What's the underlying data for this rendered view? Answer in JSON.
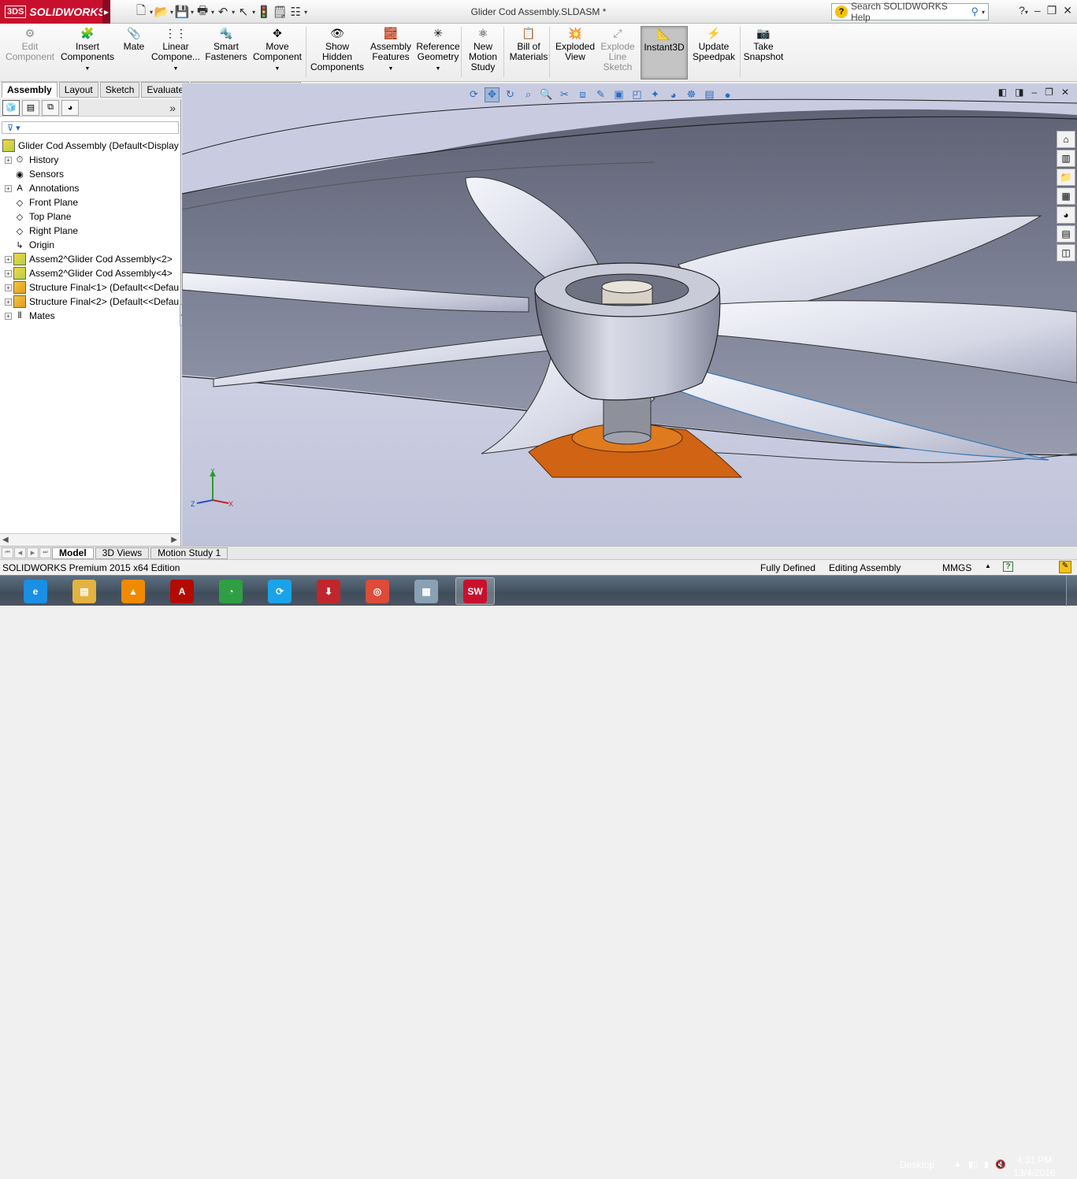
{
  "app": {
    "brand": "SOLIDWORKS",
    "brand_prefix": "3DS",
    "doc_title": "Glider Cod Assembly.SLDASM *",
    "search_placeholder": "Search SOLIDWORKS Help",
    "brand_color": "#c8102e"
  },
  "quickaccess": [
    {
      "name": "new-document-icon",
      "glyph": "🗋"
    },
    {
      "name": "open-folder-icon",
      "glyph": "📂"
    },
    {
      "name": "save-icon",
      "glyph": "💾"
    },
    {
      "name": "print-icon",
      "glyph": "🖶"
    },
    {
      "name": "undo-icon",
      "glyph": "↶"
    },
    {
      "name": "select-pointer-icon",
      "glyph": "↖"
    },
    {
      "name": "rebuild-icon",
      "glyph": "🚦"
    },
    {
      "name": "file-properties-icon",
      "glyph": "🗒"
    },
    {
      "name": "options-icon",
      "glyph": "☷"
    }
  ],
  "ribbon": [
    {
      "label_lines": [
        "Edit",
        "Component"
      ],
      "disabled": true,
      "icon": "edit-component-icon",
      "glyph": "⚙"
    },
    {
      "label_lines": [
        "Insert",
        "Components"
      ],
      "dropdown": true,
      "icon": "insert-components-icon",
      "glyph": "🧩"
    },
    {
      "label_lines": [
        "Mate"
      ],
      "icon": "mate-icon",
      "glyph": "📎"
    },
    {
      "label_lines": [
        "Linear",
        "Compone..."
      ],
      "dropdown": true,
      "icon": "linear-pattern-icon",
      "glyph": "⋮⋮"
    },
    {
      "label_lines": [
        "Smart",
        "Fasteners"
      ],
      "icon": "smart-fasteners-icon",
      "glyph": "🔩"
    },
    {
      "label_lines": [
        "Move",
        "Component"
      ],
      "dropdown": true,
      "icon": "move-component-icon",
      "glyph": "✥"
    },
    {
      "label_lines": [
        "Show",
        "Hidden",
        "Components"
      ],
      "icon": "show-hidden-icon",
      "glyph": "👁"
    },
    {
      "label_lines": [
        "Assembly",
        "Features"
      ],
      "dropdown": true,
      "icon": "assembly-features-icon",
      "glyph": "🧱"
    },
    {
      "label_lines": [
        "Reference",
        "Geometry"
      ],
      "dropdown": true,
      "icon": "reference-geometry-icon",
      "glyph": "✳"
    },
    {
      "label_lines": [
        "New",
        "Motion",
        "Study"
      ],
      "icon": "motion-study-icon",
      "glyph": "⚛"
    },
    {
      "label_lines": [
        "Bill of",
        "Materials"
      ],
      "icon": "bill-of-materials-icon",
      "glyph": "📋"
    },
    {
      "label_lines": [
        "Exploded",
        "View"
      ],
      "icon": "exploded-view-icon",
      "glyph": "💥"
    },
    {
      "label_lines": [
        "Explode",
        "Line",
        "Sketch"
      ],
      "disabled": true,
      "icon": "explode-line-sketch-icon",
      "glyph": "⤢"
    },
    {
      "label_lines": [
        "Instant3D"
      ],
      "active": true,
      "icon": "instant3d-icon",
      "glyph": "📐"
    },
    {
      "label_lines": [
        "Update",
        "Speedpak"
      ],
      "icon": "update-speedpak-icon",
      "glyph": "⚡"
    },
    {
      "label_lines": [
        "Take",
        "Snapshot"
      ],
      "icon": "take-snapshot-icon",
      "glyph": "📷"
    }
  ],
  "tabs": [
    "Assembly",
    "Layout",
    "Sketch",
    "Evaluate",
    "SOLIDWORKS Add-Ins"
  ],
  "tree": {
    "root": "Glider Cod Assembly  (Default<Display",
    "items": [
      {
        "label": "History",
        "expand": true,
        "icon": "history-icon",
        "glyph": "⏱"
      },
      {
        "label": "Sensors",
        "expand": false,
        "icon": "sensors-icon",
        "glyph": "◉"
      },
      {
        "label": "Annotations",
        "expand": true,
        "icon": "annotations-icon",
        "glyph": "A"
      },
      {
        "label": "Front Plane",
        "expand": false,
        "icon": "plane-icon",
        "glyph": "◇"
      },
      {
        "label": "Top Plane",
        "expand": false,
        "icon": "plane-icon",
        "glyph": "◇"
      },
      {
        "label": "Right Plane",
        "expand": false,
        "icon": "plane-icon",
        "glyph": "◇"
      },
      {
        "label": "Origin",
        "expand": false,
        "icon": "origin-icon",
        "glyph": "↳"
      },
      {
        "label": "Assem2^Glider Cod Assembly<2>",
        "expand": true,
        "icon": "subassembly-icon",
        "glyph": "",
        "type": "asm"
      },
      {
        "label": "Assem2^Glider Cod Assembly<4>",
        "expand": true,
        "icon": "subassembly-icon",
        "glyph": "",
        "type": "asm"
      },
      {
        "label": "Structure Final<1> (Default<<Defau",
        "expand": true,
        "icon": "part-icon",
        "glyph": "",
        "type": "part"
      },
      {
        "label": "Structure Final<2> (Default<<Defau",
        "expand": true,
        "icon": "part-icon",
        "glyph": "",
        "type": "part"
      },
      {
        "label": "Mates",
        "expand": true,
        "icon": "mates-icon",
        "glyph": "⫴"
      }
    ]
  },
  "bottom_tabs": [
    "Model",
    "3D Views",
    "Motion Study 1"
  ],
  "status": {
    "edition": "SOLIDWORKS Premium 2015 x64 Edition",
    "state": "Fully Defined",
    "mode": "Editing Assembly",
    "units": "MMGS"
  },
  "taskbar": {
    "apps": [
      {
        "name": "internet-explorer-icon",
        "glyph": "e",
        "color": "#1a8fe3"
      },
      {
        "name": "file-explorer-icon",
        "glyph": "▤",
        "color": "#e3b341"
      },
      {
        "name": "vlc-icon",
        "glyph": "▲",
        "color": "#f08a00"
      },
      {
        "name": "acrobat-icon",
        "glyph": "A",
        "color": "#b30b00"
      },
      {
        "name": "app-green-icon",
        "glyph": "◔",
        "color": "#2f9e44"
      },
      {
        "name": "shareit-icon",
        "glyph": "⟳",
        "color": "#1aa3e8"
      },
      {
        "name": "downloader-icon",
        "glyph": "⬇",
        "color": "#c0272d"
      },
      {
        "name": "chrome-icon",
        "glyph": "◎",
        "color": "#dd4b39"
      },
      {
        "name": "calculator-icon",
        "glyph": "▦",
        "color": "#8aa0b4"
      },
      {
        "name": "solidworks-taskbar-icon",
        "glyph": "SW",
        "color": "#c8102e"
      }
    ],
    "desktop_label": "Desktop",
    "time": "4:31 PM",
    "date": "13/4/2016"
  }
}
